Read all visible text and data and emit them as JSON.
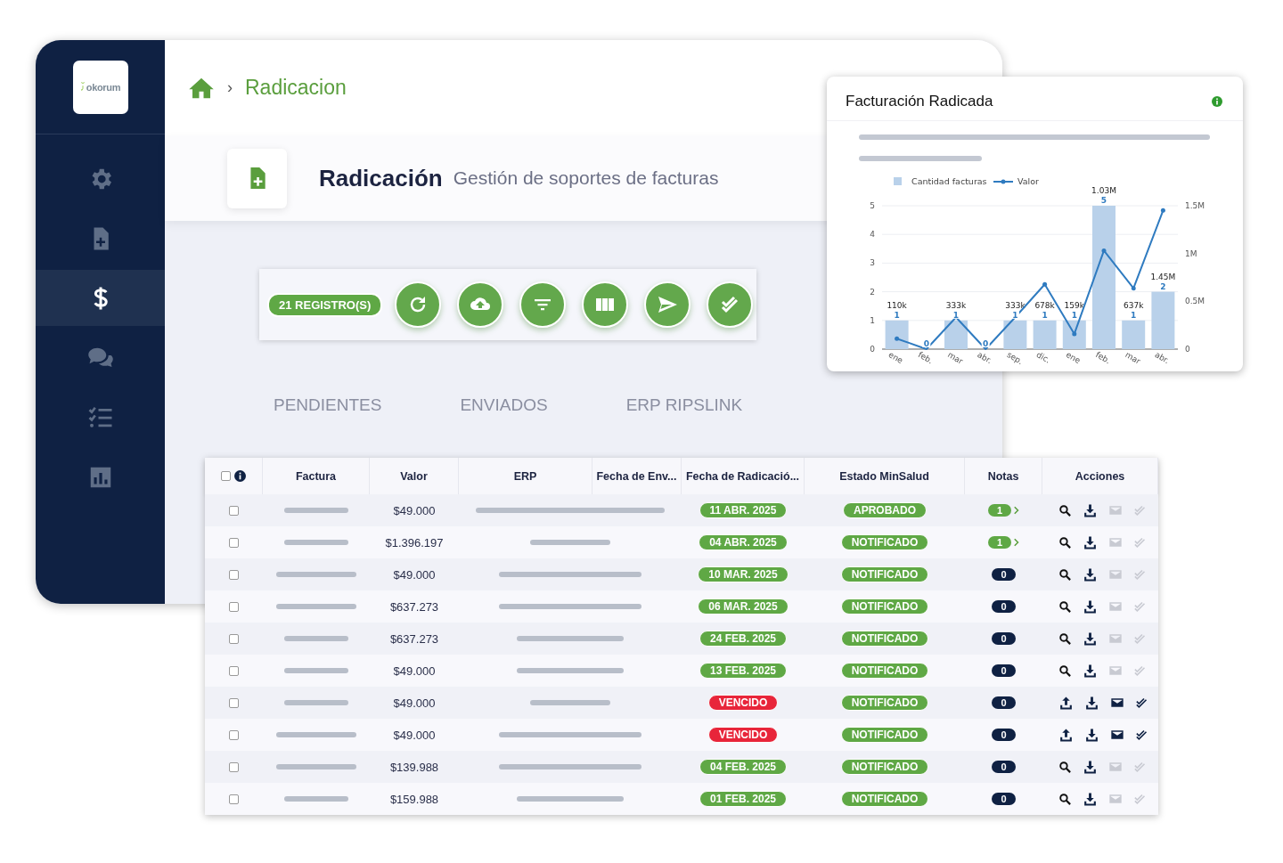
{
  "sidebar": {
    "logo": "okorum",
    "items": [
      {
        "selected": false
      },
      {
        "selected": false
      },
      {
        "selected": true
      },
      {
        "selected": false
      },
      {
        "selected": false
      },
      {
        "selected": false
      }
    ]
  },
  "breadcrumb": {
    "separator": "›",
    "current": "Radicacion"
  },
  "page_header": {
    "title": "Radicación",
    "subtitle": "Gestión de soportes de facturas"
  },
  "toolbar": {
    "count_badge": "21 REGISTRO(S)"
  },
  "tabs": [
    {
      "label": "PENDIENTES",
      "selected": false
    },
    {
      "label": "ENVIADOS",
      "selected": false
    },
    {
      "label": "ERP RIPSLINK",
      "selected": false
    }
  ],
  "chart_card": {
    "title": "Facturación Radicada",
    "layers": [
      {
        "chart_data": {
          "type": "bar",
          "categories": [
            "ene",
            "feb.",
            "mar",
            "abr.",
            "sep.",
            "dic.",
            "ene",
            "feb.",
            "mar",
            "abr."
          ],
          "ylim": [
            0,
            5
          ],
          "yticks": [
            0,
            1,
            2,
            3,
            4,
            5
          ],
          "grid": true,
          "legend": "top",
          "data_labels": true,
          "series": [
            {
              "name": "Cantidad facturas",
              "color": "#b9d1ea",
              "values": [
                1,
                0,
                1,
                0,
                1,
                1,
                1,
                5,
                1,
                2
              ]
            }
          ],
          "annotations": [
            "110k",
            null,
            "333k",
            null,
            "333k",
            "678k",
            "159k",
            "1.03M",
            "637k",
            "1.45M"
          ]
        }
      },
      {
        "chart_data": {
          "type": "line",
          "ylim": [
            0,
            1500000
          ],
          "yticks": [
            {
              "value": 0,
              "label": "0"
            },
            {
              "value": 500000,
              "label": "0.5M"
            },
            {
              "value": 1000000,
              "label": "1M"
            },
            {
              "value": 1500000,
              "label": "1.5M"
            }
          ],
          "series": [
            {
              "name": "Valor",
              "color": "#2f7bc0",
              "values": [
                110000,
                0,
                333000,
                0,
                333000,
                678000,
                159000,
                1030000,
                637000,
                1450000
              ]
            }
          ]
        }
      }
    ]
  },
  "table": {
    "select_all_checked": false,
    "columns": [
      "Factura",
      "Valor",
      "ERP",
      "Fecha de Env...",
      "Fecha de Radicació...",
      "Estado MinSalud",
      "Notas",
      "Acciones"
    ],
    "rows": [
      {
        "checked": false,
        "valor": "$49.000",
        "fecha_radicacion": {
          "text": "11 ABR. 2025",
          "overdue": false
        },
        "estado": "APROBADO",
        "notas": {
          "count": "1",
          "has_detail": true
        },
        "actions_enabled": false
      },
      {
        "checked": false,
        "valor": "$1.396.197",
        "fecha_radicacion": {
          "text": "04 ABR. 2025",
          "overdue": false
        },
        "estado": "NOTIFICADO",
        "notas": {
          "count": "1",
          "has_detail": true
        },
        "actions_enabled": false
      },
      {
        "checked": false,
        "valor": "$49.000",
        "fecha_radicacion": {
          "text": "10 MAR. 2025",
          "overdue": false
        },
        "estado": "NOTIFICADO",
        "notas": {
          "count": "0",
          "has_detail": false
        },
        "actions_enabled": false
      },
      {
        "checked": false,
        "valor": "$637.273",
        "fecha_radicacion": {
          "text": "06 MAR. 2025",
          "overdue": false
        },
        "estado": "NOTIFICADO",
        "notas": {
          "count": "0",
          "has_detail": false
        },
        "actions_enabled": false
      },
      {
        "checked": false,
        "valor": "$637.273",
        "fecha_radicacion": {
          "text": "24 FEB. 2025",
          "overdue": false
        },
        "estado": "NOTIFICADO",
        "notas": {
          "count": "0",
          "has_detail": false
        },
        "actions_enabled": false
      },
      {
        "checked": false,
        "valor": "$49.000",
        "fecha_radicacion": {
          "text": "13 FEB. 2025",
          "overdue": false
        },
        "estado": "NOTIFICADO",
        "notas": {
          "count": "0",
          "has_detail": false
        },
        "actions_enabled": false
      },
      {
        "checked": false,
        "valor": "$49.000",
        "fecha_radicacion": {
          "text": "VENCIDO",
          "overdue": true
        },
        "estado": "NOTIFICADO",
        "notas": {
          "count": "0",
          "has_detail": false
        },
        "actions_enabled": true
      },
      {
        "checked": false,
        "valor": "$49.000",
        "fecha_radicacion": {
          "text": "VENCIDO",
          "overdue": true
        },
        "estado": "NOTIFICADO",
        "notas": {
          "count": "0",
          "has_detail": false
        },
        "actions_enabled": true
      },
      {
        "checked": false,
        "valor": "$139.988",
        "fecha_radicacion": {
          "text": "04 FEB. 2025",
          "overdue": false
        },
        "estado": "NOTIFICADO",
        "notas": {
          "count": "0",
          "has_detail": false
        },
        "actions_enabled": false
      },
      {
        "checked": false,
        "valor": "$159.988",
        "fecha_radicacion": {
          "text": "01 FEB. 2025",
          "overdue": false
        },
        "estado": "NOTIFICADO",
        "notas": {
          "count": "0",
          "has_detail": false
        },
        "actions_enabled": false
      }
    ]
  }
}
